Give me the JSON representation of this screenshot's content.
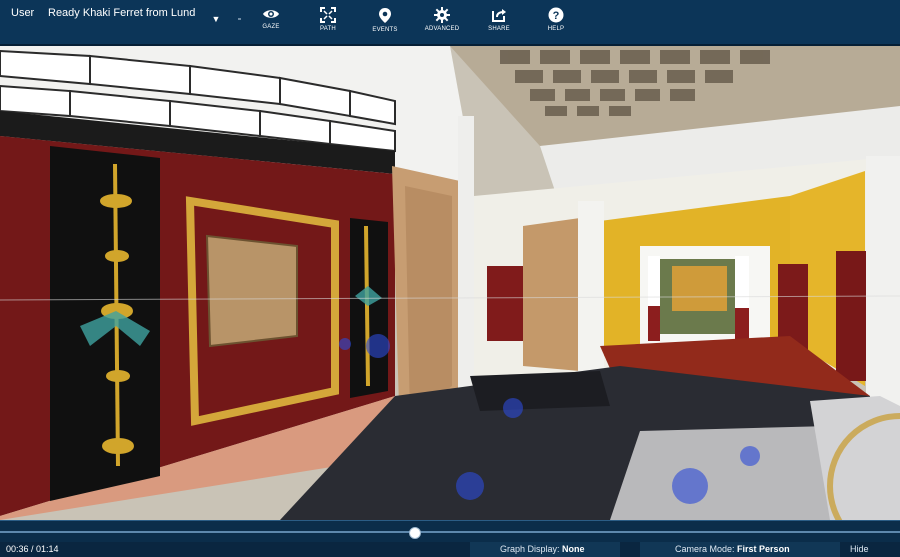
{
  "header": {
    "user_label": "User",
    "user_name": "Ready Khaki Ferret from Lund",
    "dropdown_icon": "chevron-down-icon"
  },
  "toolbar": [
    {
      "label": "GAZE",
      "icon": "eye-icon"
    },
    {
      "label": "PATH",
      "icon": "expand-icon"
    },
    {
      "label": "EVENTS",
      "icon": "map-pin-icon"
    },
    {
      "label": "ADVANCED",
      "icon": "gear-icon"
    },
    {
      "label": "SHARE",
      "icon": "share-icon"
    },
    {
      "label": "HELP",
      "icon": "help-icon"
    }
  ],
  "timeline": {
    "progress": 0.46
  },
  "status": {
    "time": "00:36 / 01:14",
    "graph_display_label": "Graph Display:",
    "graph_display_value": "None",
    "camera_mode_label": "Camera Mode:",
    "camera_mode_value": "First Person",
    "more": "Hide"
  },
  "colors": {
    "topbar": "#0c3558",
    "wall_red": "#7a1a1a",
    "wall_yellow": "#e0b52a",
    "floor": "#2b2d33"
  }
}
